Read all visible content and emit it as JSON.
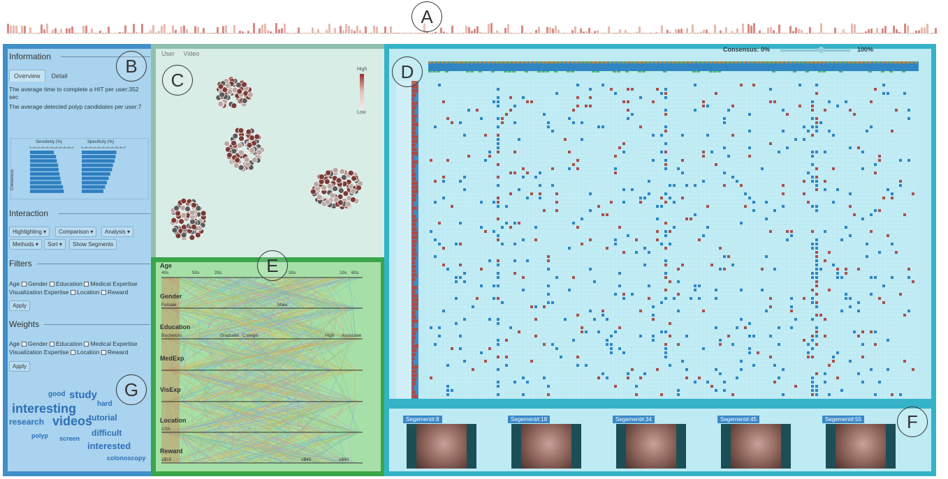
{
  "labels": {
    "a": "A",
    "b": "B",
    "c": "C",
    "d": "D",
    "e": "E",
    "f": "F",
    "g": "G"
  },
  "info": {
    "title": "Information",
    "tabs": [
      "Overview",
      "Detail"
    ],
    "stat1": "The average time to complete a HIT per user:352 sec",
    "stat2": "The average detected polyp candidates per user:7",
    "chart_sens_title": "Sensitivity (%)",
    "chart_spec_title": "Specificity (%)",
    "chart_ylabel": "Consensus",
    "chart_data": [
      {
        "type": "bar",
        "title": "Sensitivity (%)",
        "ylabel": "Consensus",
        "values": [
          55,
          60,
          62,
          65,
          66,
          68,
          70,
          72,
          76,
          78
        ]
      },
      {
        "type": "bar",
        "title": "Specificity (%)",
        "ylabel": "Consensus",
        "values": [
          80,
          78,
          76,
          72,
          70,
          66,
          62,
          58,
          54,
          50
        ]
      }
    ]
  },
  "interaction": {
    "title": "Interaction",
    "buttons": [
      "Highlighting ▾",
      "Comparison ▾",
      "Analysis ▾",
      "Methods ▾",
      "Sort ▾",
      "Show Segments"
    ]
  },
  "filters": {
    "title": "Filters",
    "options": [
      "Age",
      "Gender",
      "Education",
      "Medical Expertise",
      "Visualization Expertise",
      "Location",
      "Reward"
    ],
    "apply": "Apply"
  },
  "weights": {
    "title": "Weights",
    "options": [
      "Age",
      "Gender",
      "Education",
      "Medical Expertise",
      "Visualization Expertise",
      "Location",
      "Reward"
    ],
    "apply": "Apply"
  },
  "wordcloud": [
    {
      "text": "good",
      "size": 10
    },
    {
      "text": "study",
      "size": 15
    },
    {
      "text": "hard",
      "size": 10
    },
    {
      "text": "interesting",
      "size": 18
    },
    {
      "text": "research",
      "size": 12
    },
    {
      "text": "videos",
      "size": 18
    },
    {
      "text": "tutorial",
      "size": 12
    },
    {
      "text": "polyp",
      "size": 9
    },
    {
      "text": "screen",
      "size": 9
    },
    {
      "text": "difficult",
      "size": 12
    },
    {
      "text": "interested",
      "size": 13
    },
    {
      "text": "colonoscopy",
      "size": 9
    }
  ],
  "cluster": {
    "tabs": [
      "User",
      "Video"
    ],
    "legend_high": "High",
    "legend_low": "Low"
  },
  "parallel": {
    "axes": [
      "Age",
      "Gender",
      "Education",
      "MedExp",
      "VisExp",
      "Location",
      "Reward"
    ],
    "age_ticks": [
      "40s",
      "50s",
      "20s",
      "30s",
      "10s",
      "60s"
    ],
    "gender_ticks": [
      "Female",
      "Male"
    ],
    "edu_ticks": [
      "Bachelors",
      "Graduate",
      "College",
      "High",
      "Associate"
    ],
    "location_ticks": [
      "USA"
    ],
    "reward_ticks": [
      "≤$10",
      "≤$45",
      "≤$40"
    ]
  },
  "matrix": {
    "consensus_label": "Consensus: 0%",
    "consensus_max": "100%"
  },
  "segments": [
    "Segement#:8",
    "Segement#:18",
    "Segement#:34",
    "Segement#:45",
    "Segement#:55"
  ]
}
